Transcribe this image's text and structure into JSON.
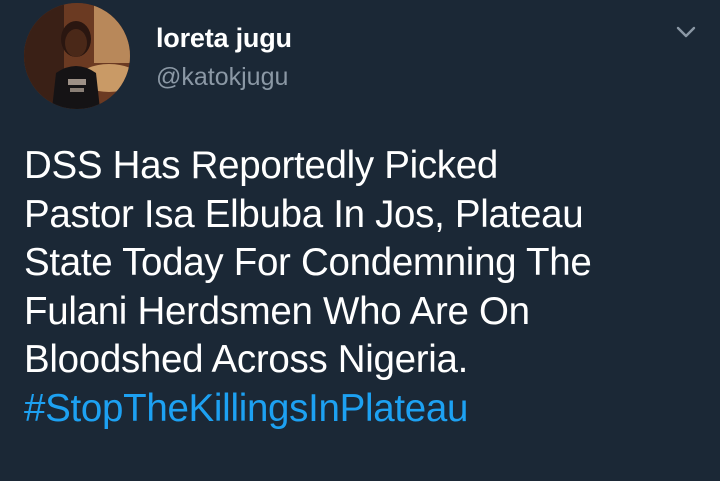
{
  "author": {
    "display_name": "loreta jugu",
    "handle": "@katokjugu",
    "avatar_icon": "user-avatar-photo"
  },
  "menu": {
    "icon": "chevron-down-icon"
  },
  "tweet": {
    "lines": [
      "DSS Has Reportedly Picked",
      "Pastor Isa Elbuba In Jos, Plateau",
      "State Today For Condemning The",
      "Fulani Herdsmen Who Are On",
      "Bloodshed Across Nigeria."
    ],
    "hashtag": "#StopTheKillingsInPlateau"
  },
  "colors": {
    "background": "#1b2836",
    "text": "#ffffff",
    "secondary_text": "#8b98a5",
    "hashtag": "#1da1f2"
  }
}
